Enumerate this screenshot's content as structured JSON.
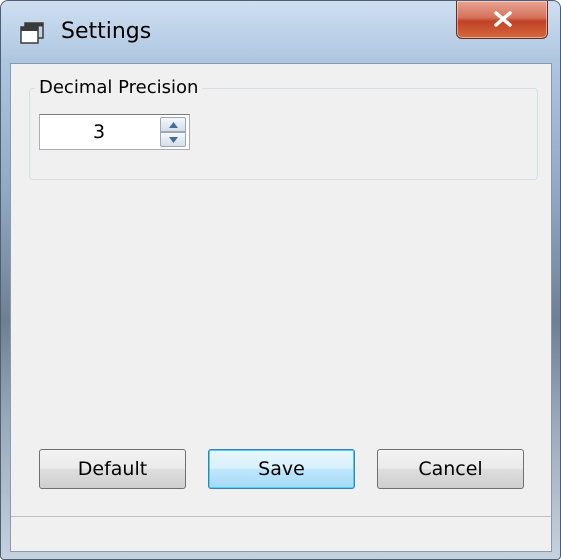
{
  "window": {
    "title": "Settings",
    "title_icon": "window-stack-icon",
    "close_icon": "close-x-icon"
  },
  "precision_group": {
    "label": "Decimal Precision",
    "value": "3",
    "up_icon": "spin-up-arrow-icon",
    "down_icon": "spin-down-arrow-icon"
  },
  "buttons": {
    "default_label": "Default",
    "save_label": "Save",
    "cancel_label": "Cancel"
  },
  "statusbar": {
    "text": ""
  },
  "colors": {
    "close_button": "#c24125",
    "focused_button_border": "#3c7fb1",
    "client_background": "#f0f0f0"
  }
}
